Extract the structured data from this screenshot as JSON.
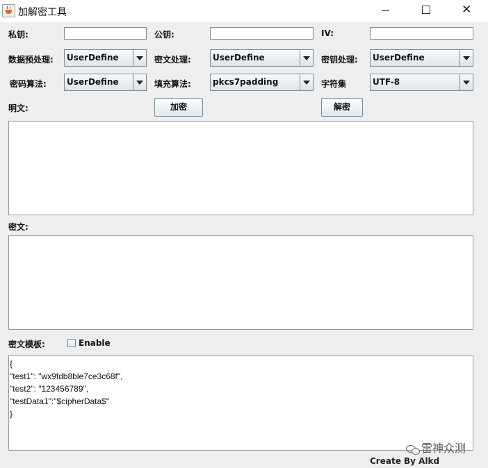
{
  "window": {
    "title": "加解密工具",
    "controls": {
      "minimize": "minimize-icon",
      "maximize": "maximize-icon",
      "close": "close-icon"
    }
  },
  "fields": {
    "private_key_label": "私钥:",
    "public_key_label": "公钥:",
    "iv_label": "IV:",
    "private_key_value": "",
    "public_key_value": "",
    "iv_value": ""
  },
  "combos": {
    "data_preprocess_label": "数据预处理:",
    "data_preprocess_value": "UserDefine",
    "cipher_process_label": "密文处理:",
    "cipher_process_value": "UserDefine",
    "key_process_label": "密钥处理:",
    "key_process_value": "UserDefine",
    "algorithm_label": "密码算法:",
    "algorithm_value": "UserDefine",
    "padding_label": "填充算法:",
    "padding_value": "pkcs7padding",
    "charset_label": "字符集",
    "charset_value": "UTF-8"
  },
  "actions": {
    "plaintext_label": "明文:",
    "encrypt_label": "加密",
    "decrypt_label": "解密"
  },
  "areas": {
    "plaintext_value": "",
    "ciphertext_label": "密文:",
    "ciphertext_value": "",
    "template_label": "密文模板:",
    "template_enable_label": "Enable",
    "template_enabled": false,
    "template_lines": [
      "{",
      "\"test1\": \"wx9fdb8ble7ce3c68f\",",
      "\"test2\": \"123456789\",",
      "\"testData1\":\"$cipherData$\"",
      "}"
    ]
  },
  "watermark": "雷神众测",
  "footer": {
    "credit": "Create By Alkd"
  }
}
